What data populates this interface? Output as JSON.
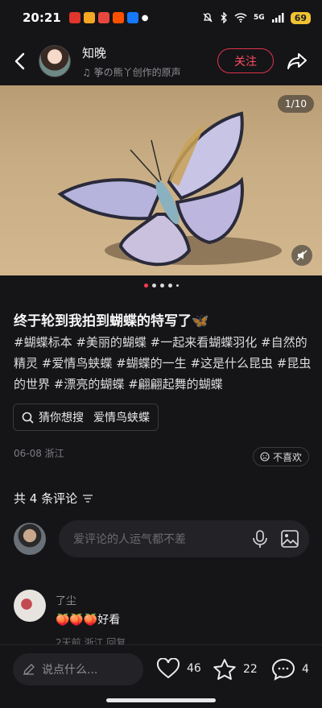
{
  "status_bar": {
    "time": "20:21",
    "app_icons": [
      "weibo-icon",
      "weibo-icon-2",
      "app-icon-red",
      "taobao-icon",
      "alipay-icon"
    ],
    "network": "5G",
    "battery": "69"
  },
  "author": {
    "name": "知晚",
    "music": "筝の熊丫创作的原声",
    "follow_label": "关注"
  },
  "media": {
    "counter": "1/10"
  },
  "post": {
    "title": "终于轮到我拍到蝴蝶的特写了🦋",
    "tags": "#蝴蝶标本 #美丽的蝴蝶 #一起来看蝴蝶羽化 #自然的精灵 #爱情鸟蛱蝶 #蝴蝶的一生 #这是什么昆虫 #昆虫的世界 #漂亮的蝴蝶 #翩翩起舞的蝴蝶",
    "search_prefix": "猜你想搜",
    "search_term": "爱情鸟蛱蝶",
    "date_location": "06-08 浙江",
    "dislike_label": "不喜欢"
  },
  "comments": {
    "count_label": "共 4 条评论",
    "input_placeholder": "爱评论的人运气都不差",
    "items": [
      {
        "name": "了尘",
        "text": "🍑🍑🍑好看",
        "meta": "2天前 浙江  回复"
      }
    ]
  },
  "bottom": {
    "say_placeholder": "说点什么...",
    "likes": "46",
    "favorites": "22",
    "comments": "4"
  }
}
